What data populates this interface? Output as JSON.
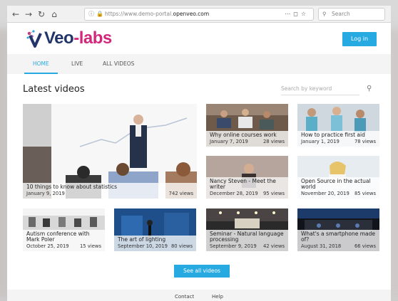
{
  "browser": {
    "url_prefix": "https://www.demo-portal.",
    "url_domain": "openveo.com",
    "search_placeholder": "Search"
  },
  "brand": {
    "part1": "Veo",
    "part2": "-labs"
  },
  "header": {
    "login_label": "Log in"
  },
  "tabs": [
    {
      "label": "HOME",
      "active": true
    },
    {
      "label": "LIVE",
      "active": false
    },
    {
      "label": "ALL VIDEOS",
      "active": false
    }
  ],
  "main": {
    "title": "Latest videos",
    "search_placeholder": "Search by keyword",
    "see_all_label": "See all videos"
  },
  "videos": [
    {
      "title": "10 things to know about statistics",
      "date": "January 9, 2019",
      "views": "742 views"
    },
    {
      "title": "Why online courses work",
      "date": "January 7, 2019",
      "views": "28 views"
    },
    {
      "title": "How to practice first aid",
      "date": "January 1, 2019",
      "views": "78 views"
    },
    {
      "title": "Nancy Steven - Meet the writer",
      "date": "December 28, 2019",
      "views": "95 views"
    },
    {
      "title": "Open Source in the actual world",
      "date": "November 20, 2019",
      "views": "85 views"
    },
    {
      "title": "Autism conference with Mark Poler",
      "date": "October 25, 2019",
      "views": "15 views"
    },
    {
      "title": "The art of lighting",
      "date": "September 10, 2019",
      "views": "80 views"
    },
    {
      "title": "Seminar - Natural language processing",
      "date": "September 9, 2019",
      "views": "42 views"
    },
    {
      "title": "What's a smartphone made of?",
      "date": "August 31, 2018",
      "views": "66 views"
    }
  ],
  "footer": {
    "contact": "Contact",
    "help": "Help"
  },
  "colors": {
    "accent": "#27a9e1",
    "brand_dark": "#22356b",
    "brand_pink": "#d1287c"
  }
}
